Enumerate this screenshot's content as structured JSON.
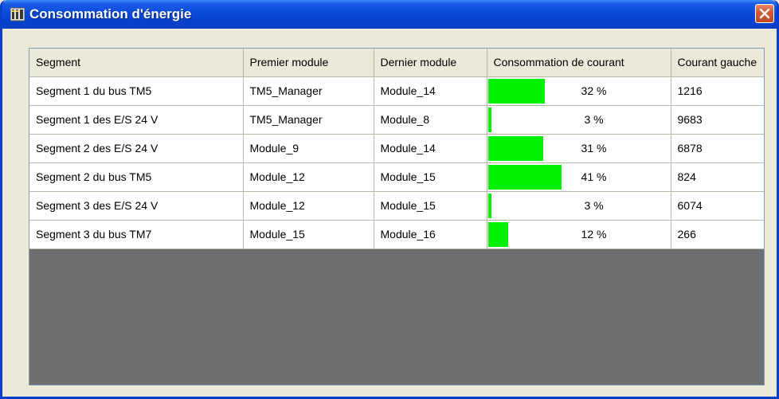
{
  "window": {
    "title": "Consommation d'énergie",
    "app_icon": "module-rack-icon",
    "close_icon": "close-icon"
  },
  "colors": {
    "titlebar": "#0a49d8",
    "bar_fill": "#00f000",
    "grid_background": "#6f6f6f",
    "dialog_background": "#ece9d8"
  },
  "table": {
    "columns": [
      "Segment",
      "Premier module",
      "Dernier module",
      "Consommation de courant",
      "Courant gauche"
    ],
    "rows": [
      {
        "segment": "Segment 1 du bus TM5",
        "level": 1,
        "first": "TM5_Manager",
        "last": "Module_14",
        "pct": 32,
        "pct_label": "32 %",
        "left": "1216"
      },
      {
        "segment": "Segment 1 des E/S 24 V",
        "level": 2,
        "first": "TM5_Manager",
        "last": "Module_8",
        "pct": 3,
        "pct_label": "3 %",
        "left": "9683"
      },
      {
        "segment": "Segment 2 des E/S 24 V",
        "level": 2,
        "first": "Module_9",
        "last": "Module_14",
        "pct": 31,
        "pct_label": "31 %",
        "left": "6878"
      },
      {
        "segment": "Segment 2 du bus TM5",
        "level": 1,
        "first": "Module_12",
        "last": "Module_15",
        "pct": 41,
        "pct_label": "41 %",
        "left": "824"
      },
      {
        "segment": "Segment 3 des E/S 24 V",
        "level": 2,
        "first": "Module_12",
        "last": "Module_15",
        "pct": 3,
        "pct_label": "3 %",
        "left": "6074"
      },
      {
        "segment": "Segment 3 du bus TM7",
        "level": 1,
        "first": "Module_15",
        "last": "Module_16",
        "pct": 12,
        "pct_label": "12 %",
        "left": "266"
      }
    ]
  }
}
